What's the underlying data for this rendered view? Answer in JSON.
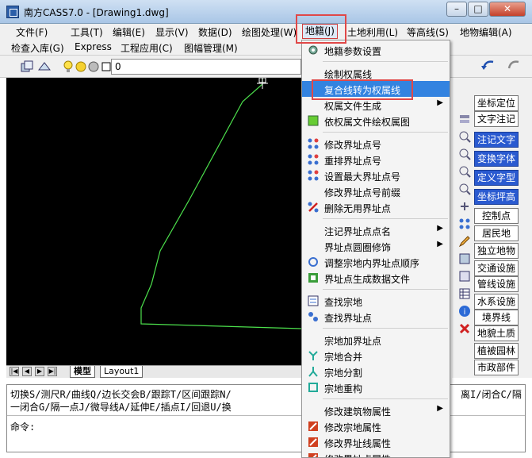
{
  "window": {
    "title": "南方CASS7.0 - [Drawing1.dwg]",
    "minimize": "–",
    "maximize": "□",
    "close": "✕",
    "inner_minimize": "–",
    "inner_restore": "▫",
    "inner_close": "✕"
  },
  "menubar1": [
    "文件(F)",
    "工具(T)",
    "编辑(E)",
    "显示(V)",
    "数据(D)",
    "绘图处理(W)",
    "地籍(J)",
    "土地利用(L)",
    "等高线(S)",
    "地物编辑(A)"
  ],
  "menubar2": [
    "检查入库(G)",
    "Express",
    "工程应用(C)",
    "图幅管理(M)"
  ],
  "toolbar": {
    "layer_value": "0"
  },
  "dropdown": {
    "items": [
      {
        "label": "地籍参数设置",
        "icon": "settings-icon",
        "submenu": false
      },
      {
        "sep": true
      },
      {
        "label": "绘制权属线",
        "icon": "",
        "submenu": false
      },
      {
        "label": "复合线转为权属线",
        "icon": "",
        "submenu": false,
        "highlight": true
      },
      {
        "label": "权属文件生成",
        "icon": "",
        "submenu": true
      },
      {
        "label": "依权属文件绘权属图",
        "icon": "draw-icon",
        "submenu": false
      },
      {
        "sep": true
      },
      {
        "label": "修改界址点号",
        "icon": "points-icon",
        "submenu": false
      },
      {
        "label": "重排界址点号",
        "icon": "points-icon",
        "submenu": false
      },
      {
        "label": "设置最大界址点号",
        "icon": "points-icon",
        "submenu": false
      },
      {
        "label": "修改界址点号前缀",
        "icon": "",
        "submenu": false
      },
      {
        "label": "删除无用界址点",
        "icon": "delete-points-icon",
        "submenu": false
      },
      {
        "sep": true
      },
      {
        "label": "注记界址点点名",
        "icon": "",
        "submenu": true
      },
      {
        "label": "界址点圆圈修饰",
        "icon": "",
        "submenu": true
      },
      {
        "label": "调整宗地内界址点顺序",
        "icon": "cycle-icon",
        "submenu": false
      },
      {
        "label": "界址点生成数据文件",
        "icon": "file-icon",
        "submenu": false
      },
      {
        "sep": true
      },
      {
        "label": "查找宗地",
        "icon": "find-icon",
        "submenu": false
      },
      {
        "label": "查找界址点",
        "icon": "find-points-icon",
        "submenu": false
      },
      {
        "sep": true
      },
      {
        "label": "宗地加界址点",
        "icon": "",
        "submenu": false
      },
      {
        "label": "宗地合并",
        "icon": "merge-icon",
        "submenu": false
      },
      {
        "label": "宗地分割",
        "icon": "split-icon",
        "submenu": false
      },
      {
        "label": "宗地重构",
        "icon": "rebuild-icon",
        "submenu": false
      },
      {
        "sep": true
      },
      {
        "label": "修改建筑物属性",
        "icon": "",
        "submenu": true
      },
      {
        "label": "修改宗地属性",
        "icon": "edit-icon",
        "submenu": false
      },
      {
        "label": "修改界址线属性",
        "icon": "edit-icon",
        "submenu": false
      },
      {
        "label": "修改界址点属性",
        "icon": "edit-icon",
        "submenu": false
      }
    ]
  },
  "tabs": {
    "model": "模型",
    "layout": "Layout1"
  },
  "command": {
    "line1": "切换S/测尺R/曲线Q/边长交会B/跟踪T/区间跟踪N/",
    "line1_right": "离I/闭合C/隔",
    "line2": "一闭合G/隔一点J/微导线A/延伸E/插点I/回退U/换",
    "prompt": "命令:"
  },
  "right_panel": {
    "buttons": [
      "坐标定位",
      "文字注记",
      "注记文字",
      "变换字体",
      "定义字型",
      "坐标坪高",
      "控制点",
      "居民地",
      "独立地物",
      "交通设施",
      "管线设施",
      "水系设施",
      "境界线",
      "地貌土质",
      "植被园林",
      "市政部件"
    ],
    "blue_indices": [
      2,
      3,
      4,
      5
    ]
  },
  "colors": {
    "highlight": "#3383e0",
    "polyline": "#4ce04c",
    "accent_red": "#e04848"
  }
}
